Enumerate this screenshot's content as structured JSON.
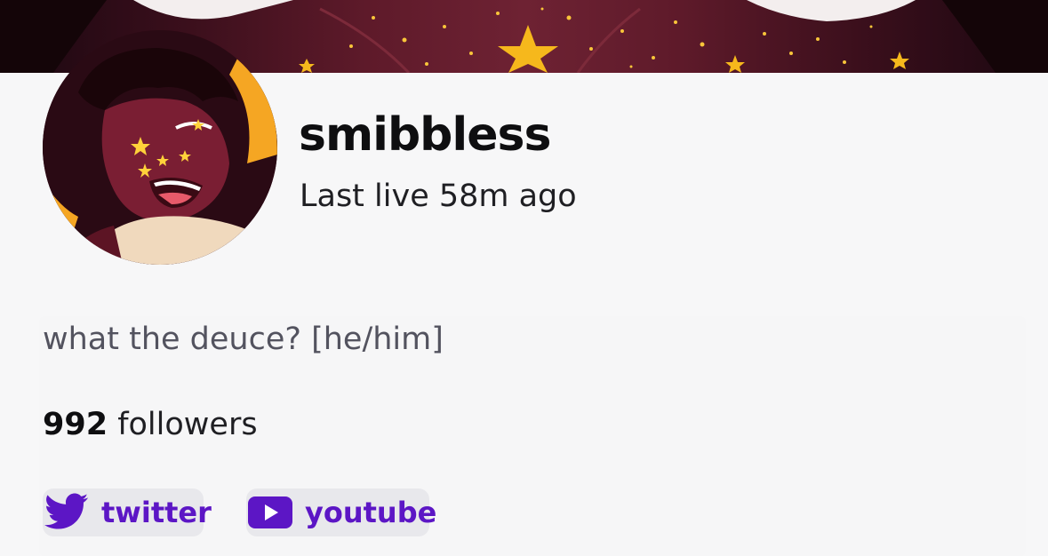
{
  "channel": {
    "name": "smibbless",
    "last_live": "Last live 58m ago",
    "bio": "what the deuce? [he/him]",
    "followers_count": "992",
    "followers_label": " followers"
  },
  "social_links": [
    {
      "label": "twitter",
      "icon": "twitter-bird-icon"
    },
    {
      "label": "youtube",
      "icon": "youtube-play-icon"
    }
  ],
  "colors": {
    "link_purple": "#5c16c5",
    "background": "#f7f7f8",
    "banner_maroon": "#5e1a2a",
    "star_yellow": "#fbc02d"
  }
}
